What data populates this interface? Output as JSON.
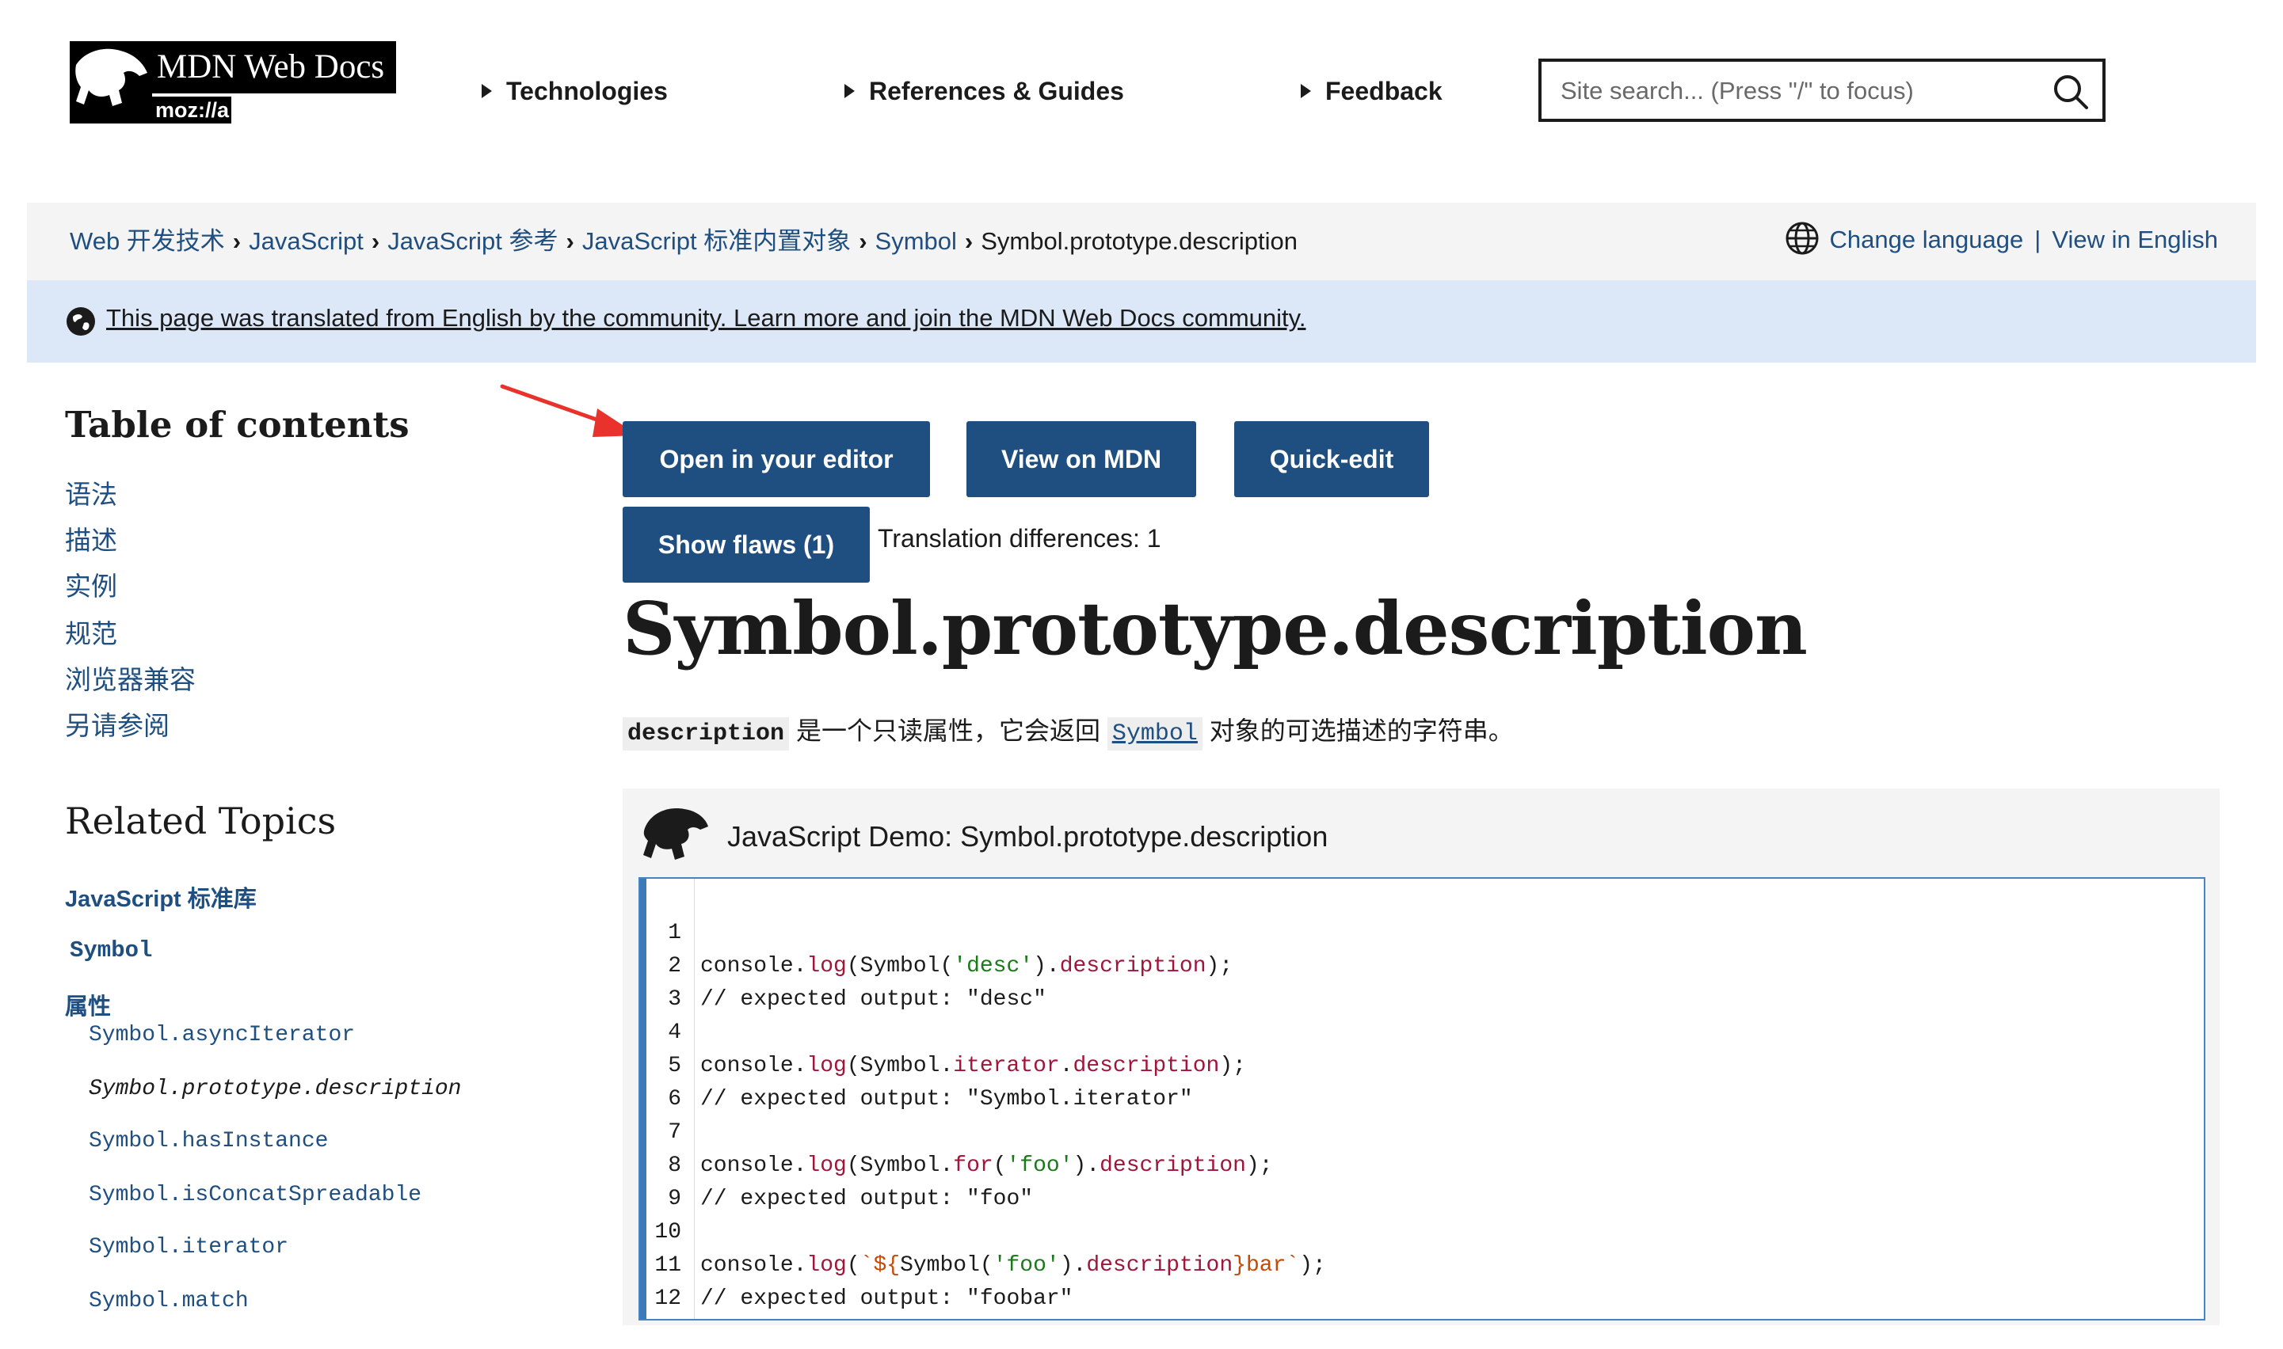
{
  "header": {
    "logo_text": "MDN Web Docs",
    "logo_moz": "moz://a",
    "nav": [
      "Technologies",
      "References & Guides",
      "Feedback"
    ],
    "search_placeholder": "Site search... (Press \"/\" to focus)",
    "search_icon": "search-icon"
  },
  "breadcrumb": {
    "items": [
      "Web 开发技术",
      "JavaScript",
      "JavaScript 参考",
      "JavaScript 标准内置对象",
      "Symbol"
    ],
    "current": "Symbol.prototype.description"
  },
  "language": {
    "change": "Change language",
    "separator": "|",
    "view_english": "View in English",
    "icon": "globe-icon"
  },
  "notice": {
    "text": "This page was translated from English by the community. Learn more and join the MDN Web Docs community."
  },
  "toc": {
    "title": "Table of contents",
    "items": [
      "语法",
      "描述",
      "实例",
      "规范",
      "浏览器兼容",
      "另请参阅"
    ]
  },
  "related": {
    "title": "Related Topics",
    "stdlib": "JavaScript 标准库",
    "symbol": "Symbol",
    "properties_label": "属性",
    "properties": [
      "Symbol.asyncIterator",
      "Symbol.prototype.description",
      "Symbol.hasInstance",
      "Symbol.isConcatSpreadable",
      "Symbol.iterator",
      "Symbol.match"
    ]
  },
  "toolbar": {
    "open_editor": "Open in your editor",
    "view_mdn": "View on MDN",
    "quick_edit": "Quick-edit",
    "show_flaws": "Show flaws (1)",
    "translation_diff": "Translation differences: 1"
  },
  "page": {
    "title": "Symbol.prototype.description",
    "desc_code": "description",
    "desc_part1": "是一个只读属性，它会返回",
    "desc_link": "Symbol",
    "desc_part2": "对象的可选描述的字符串。"
  },
  "demo": {
    "title": "JavaScript Demo: Symbol.prototype.description",
    "line_numbers": [
      "1",
      "2",
      "3",
      "4",
      "5",
      "6",
      "7",
      "8",
      "9",
      "10",
      "11",
      "12"
    ],
    "code": {
      "l1": [
        "console.",
        "log",
        "(Symbol(",
        "'desc'",
        ").",
        "description",
        ");"
      ],
      "l2": "// expected output: \"desc\"",
      "l4": [
        "console.",
        "log",
        "(Symbol.",
        "iterator",
        ".",
        "description",
        ");"
      ],
      "l5": "// expected output: \"Symbol.iterator\"",
      "l7": [
        "console.",
        "log",
        "(Symbol.",
        "for",
        "(",
        "'foo'",
        ").",
        "description",
        ");"
      ],
      "l8": "// expected output: \"foo\"",
      "l10": [
        "console.",
        "log",
        "(",
        "`${",
        "Symbol(",
        "'foo'",
        ").",
        "description",
        "}bar`",
        ");"
      ],
      "l11": "// expected output: \"foobar\""
    }
  },
  "colors": {
    "accent": "#1f4f80",
    "notice_bg": "#dce8f8",
    "arrow": "#e8322b"
  }
}
